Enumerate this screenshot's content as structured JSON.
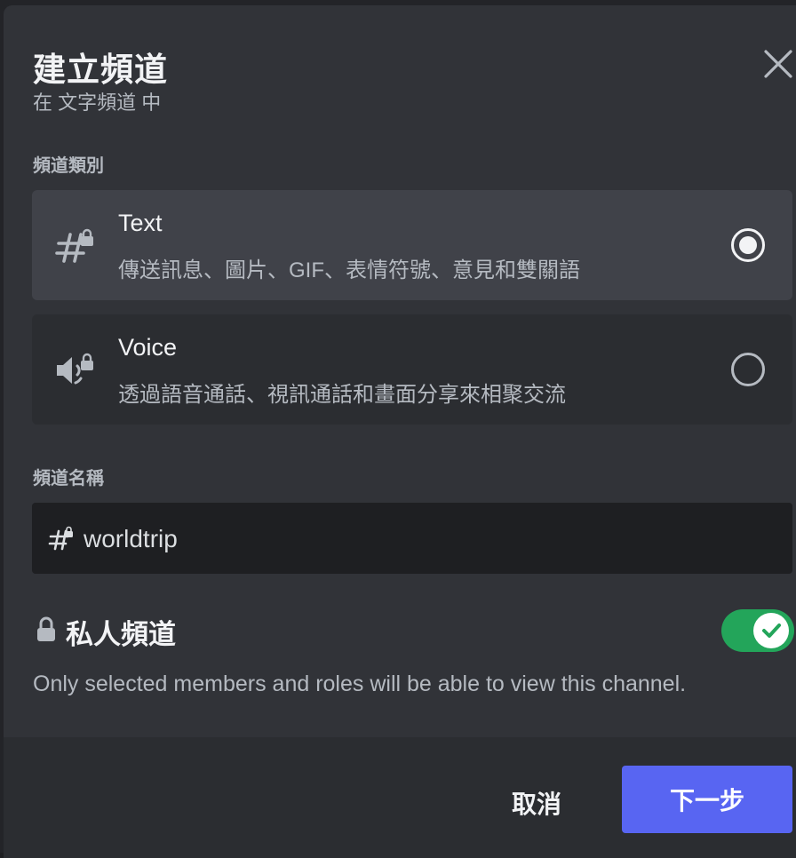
{
  "modal": {
    "title": "建立頻道",
    "subtitle": "在 文字頻道 中"
  },
  "channel_type": {
    "section_label": "頻道類別",
    "options": [
      {
        "name": "Text",
        "description": "傳送訊息、圖片、GIF、表情符號、意見和雙關語",
        "icon": "hashtag-lock-icon",
        "selected": true
      },
      {
        "name": "Voice",
        "description": "透過語音通話、視訊通話和畫面分享來相聚交流",
        "icon": "speaker-lock-icon",
        "selected": false
      }
    ]
  },
  "channel_name": {
    "section_label": "頻道名稱",
    "value": "worldtrip",
    "icon": "hashtag-lock-icon"
  },
  "private": {
    "label": "私人頻道",
    "enabled": true,
    "description": "Only selected members and roles will be able to view this channel.",
    "icon": "lock-icon"
  },
  "footer": {
    "cancel_label": "取消",
    "next_label": "下一步"
  },
  "colors": {
    "accent": "#5865f2",
    "toggle_on": "#23a55a",
    "modal_bg": "#313338",
    "selected_bg": "#404249"
  }
}
